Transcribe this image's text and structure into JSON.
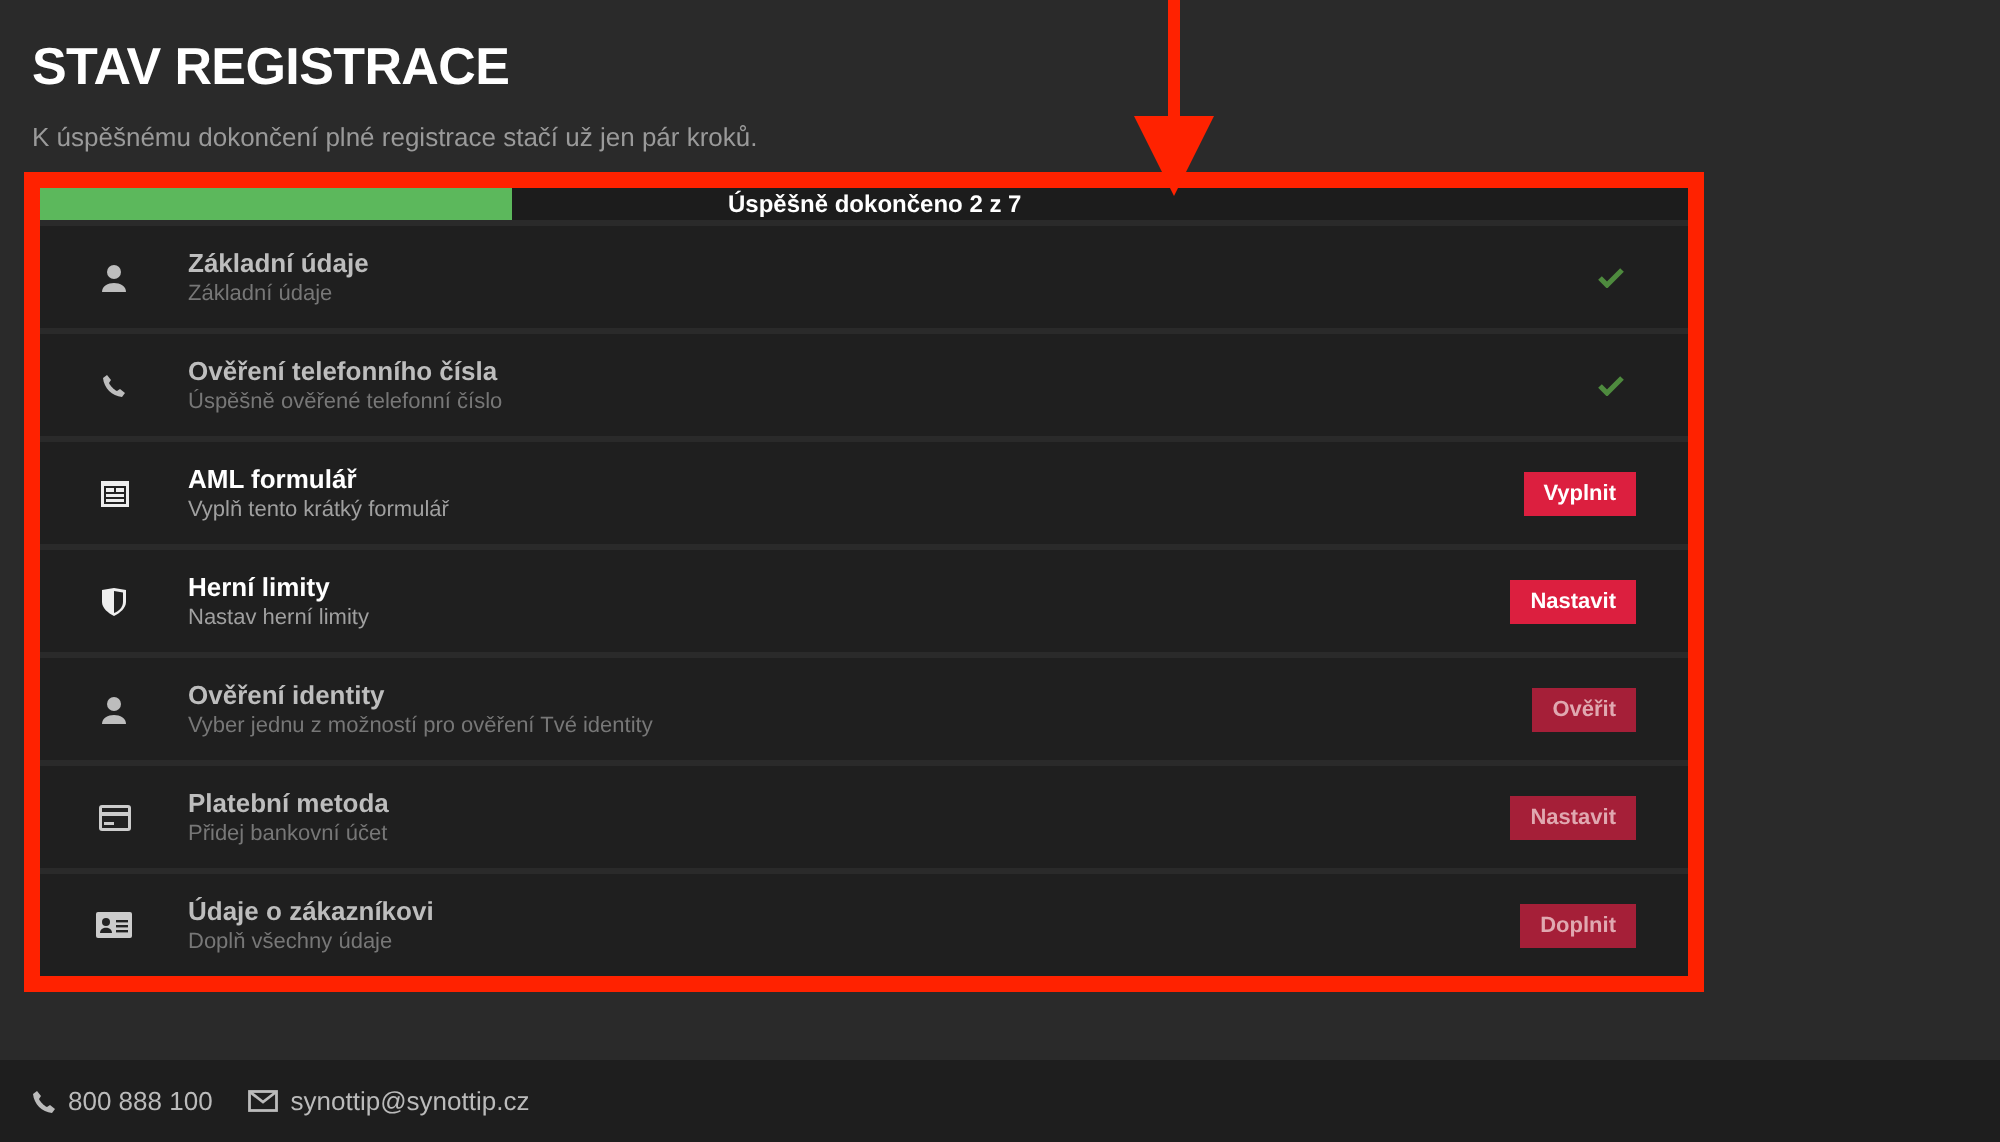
{
  "header": {
    "title": "STAV REGISTRACE",
    "subtitle": "K úspěšnému dokončení plné registrace stačí už jen pár kroků."
  },
  "progress": {
    "level": 0.286,
    "label": "Úspěšně dokončeno 2 z 7"
  },
  "steps": [
    {
      "title": "Základní údaje",
      "description": "Základní údaje",
      "completed": true,
      "disabled": false
    },
    {
      "title": "Ověření telefonního čísla",
      "description": "Úspěšně ověřené telefonní číslo",
      "completed": true,
      "disabled": false
    },
    {
      "title": "AML formulář",
      "description": "Vyplň tento krátký formulář",
      "completed": false,
      "disabled": false,
      "action": "Vyplnit"
    },
    {
      "title": "Herní limity",
      "description": "Nastav herní limity",
      "completed": false,
      "disabled": false,
      "action": "Nastavit"
    },
    {
      "title": "Ověření identity",
      "description": "Vyber jednu z možností pro ověření Tvé identity",
      "completed": false,
      "disabled": true,
      "action": "Ověřit"
    },
    {
      "title": "Platební metoda",
      "description": "Přidej bankovní účet",
      "completed": false,
      "disabled": true,
      "action": "Nastavit"
    },
    {
      "title": "Údaje o zákazníkovi",
      "description": "Doplň všechny údaje",
      "completed": false,
      "disabled": true,
      "action": "Doplnit"
    }
  ],
  "footer": {
    "phone": "800 888 100",
    "email": "synottip@synottip.cz"
  }
}
